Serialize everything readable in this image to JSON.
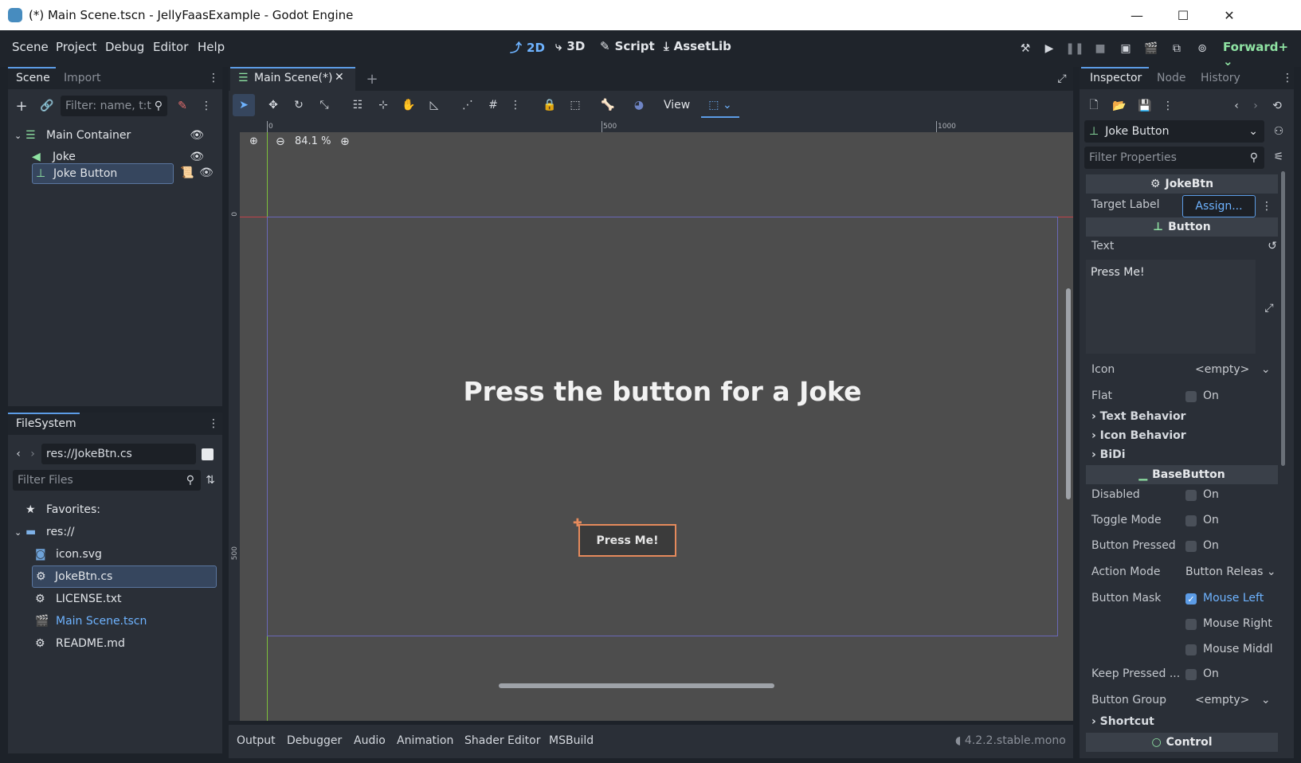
{
  "window": {
    "title": "(*) Main Scene.tscn - JellyFaasExample - Godot Engine",
    "minimize": "—",
    "maximize": "☐",
    "close": "✕"
  },
  "menu": [
    "Scene",
    "Project",
    "Debug",
    "Editor",
    "Help"
  ],
  "workspaces": {
    "w2d": "2D",
    "w3d": "3D",
    "script": "Script",
    "assetlib": "AssetLib"
  },
  "renderer": "Forward+",
  "scene_dock": {
    "tab_scene": "Scene",
    "tab_import": "Import",
    "filter_placeholder": "Filter: name, t:t",
    "nodes": [
      {
        "name": "Main Container"
      },
      {
        "name": "Joke"
      },
      {
        "name": "Joke Button"
      }
    ]
  },
  "filesystem": {
    "tab": "FileSystem",
    "path": "res://JokeBtn.cs",
    "filter_placeholder": "Filter Files",
    "favorites": "Favorites:",
    "root": "res://",
    "files": [
      "icon.svg",
      "JokeBtn.cs",
      "LICENSE.txt",
      "Main Scene.tscn",
      "README.md"
    ]
  },
  "editor": {
    "tab_label": "Main Scene(*)",
    "view_label": "View",
    "zoom": "84.1 %",
    "ruler_500": "500",
    "ruler_1000": "1000",
    "ruler_0": "0",
    "vruler_0": "0",
    "vruler_500": "500",
    "canvas_label": "Press the button for a Joke",
    "canvas_button": "Press Me!"
  },
  "bottom_panel": {
    "tabs": [
      "Output",
      "Debugger",
      "Audio",
      "Animation",
      "Shader Editor",
      "MSBuild"
    ],
    "version": "4.2.2.stable.mono"
  },
  "inspector": {
    "tab_inspector": "Inspector",
    "tab_node": "Node",
    "tab_history": "History",
    "object": "Joke Button",
    "filter_placeholder": "Filter Properties",
    "sec_jokebtn": "JokeBtn",
    "target_label": "Target Label",
    "assign": "Assign...",
    "sec_button": "Button",
    "text_label": "Text",
    "text_value": "Press Me!",
    "icon_label": "Icon",
    "icon_value": "<empty>",
    "flat_label": "Flat",
    "on": "On",
    "text_behavior": "Text Behavior",
    "icon_behavior": "Icon Behavior",
    "bidi": "BiDi",
    "sec_basebutton": "BaseButton",
    "disabled": "Disabled",
    "toggle_mode": "Toggle Mode",
    "button_pressed": "Button Pressed",
    "action_mode": "Action Mode",
    "action_mode_value": "Button Releas",
    "button_mask": "Button Mask",
    "mouse_left": "Mouse Left",
    "mouse_right": "Mouse Right",
    "mouse_middle": "Mouse Middl",
    "keep_pressed": "Keep Pressed ...",
    "button_group": "Button Group",
    "button_group_value": "<empty>",
    "shortcut": "Shortcut",
    "sec_control": "Control"
  },
  "colors": {
    "accent": "#5c9ce6",
    "renderer_green": "#8fe3a3",
    "selection_orange": "#e58a5c"
  }
}
